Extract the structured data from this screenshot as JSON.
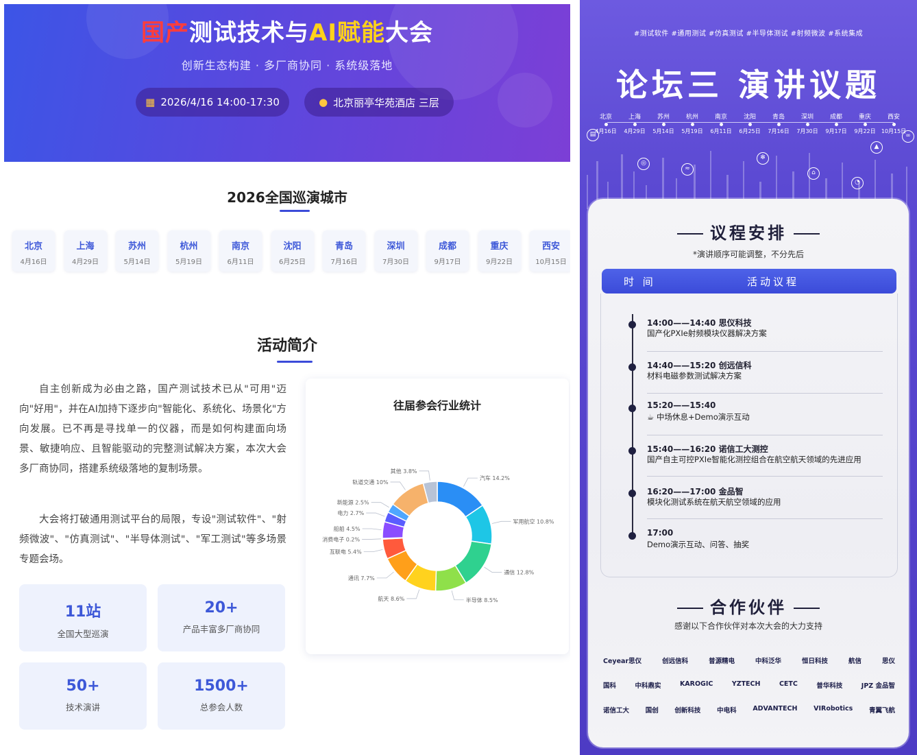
{
  "left": {
    "hero": {
      "title_red": "国产",
      "title_mid": "测试技术与",
      "title_ai": "AI",
      "title_gold": "赋能",
      "title_end": "大会",
      "subtitle": "创新生态构建 · 多厂商协同 · 系统级落地",
      "date": "2026/4/16 14:00-17:30",
      "venue": "北京丽亭华苑酒店 三层"
    },
    "tour": {
      "title": "2026全国巡演城市",
      "cities": [
        {
          "name": "北京",
          "date": "4月16日"
        },
        {
          "name": "上海",
          "date": "4月29日"
        },
        {
          "name": "苏州",
          "date": "5月14日"
        },
        {
          "name": "杭州",
          "date": "5月19日"
        },
        {
          "name": "南京",
          "date": "6月11日"
        },
        {
          "name": "沈阳",
          "date": "6月25日"
        },
        {
          "name": "青岛",
          "date": "7月16日"
        },
        {
          "name": "深圳",
          "date": "7月30日"
        },
        {
          "name": "成都",
          "date": "9月17日"
        },
        {
          "name": "重庆",
          "date": "9月22日"
        },
        {
          "name": "西安",
          "date": "10月15日"
        }
      ]
    },
    "intro": {
      "title": "活动简介",
      "p1": "自主创新成为必由之路，国产测试技术已从\"可用\"迈向\"好用\"，并在AI加持下逐步向\"智能化、系统化、场景化\"方向发展。已不再是寻找单一的仪器，而是如何构建面向场景、敏捷响应、且智能驱动的完整测试解决方案，本次大会多厂商协同，搭建系统级落地的复制场景。",
      "p2": "大会将打破通用测试平台的局限，专设\"测试软件\"、\"射频微波\"、\"仿真测试\"、\"半导体测试\"、\"军工测试\"等多场景专题会场。"
    },
    "stats": [
      {
        "num": "11站",
        "label": "全国大型巡演"
      },
      {
        "num": "20+",
        "label": "产品丰富多厂商协同"
      },
      {
        "num": "50+",
        "label": "技术演讲"
      },
      {
        "num": "1500+",
        "label": "总参会人数"
      }
    ]
  },
  "chart_data": {
    "type": "pie",
    "title": "往届参会行业统计",
    "categories": [
      "汽车",
      "军用航空",
      "通信",
      "半导体",
      "航天",
      "通讯",
      "互联电",
      "消费电子",
      "船舶",
      "电力",
      "新能源",
      "轨道交通",
      "其他"
    ],
    "values": [
      14.2,
      10.8,
      12.8,
      8.5,
      8.6,
      7.7,
      5.4,
      0.2,
      4.5,
      2.7,
      2.5,
      10.0,
      3.8
    ],
    "labels": [
      "汽车 14.2%",
      "军用航空 10.8%",
      "通信 12.8%",
      "半导体 8.5%",
      "航天 8.6%",
      "通讯 7.7%",
      "互联电 5.4%",
      "消费电子 0.2%",
      "船舶 4.5%",
      "电力 2.7%",
      "新能源 2.5%",
      "轨道交通 10%",
      "其他 3.8%"
    ],
    "colors": [
      "#2a8ef5",
      "#1ec6e6",
      "#2fd18f",
      "#8fe04a",
      "#ffd21e",
      "#ff9f1a",
      "#ff5a3c",
      "#ff4d8c",
      "#8a4dff",
      "#5a5dff",
      "#4fa7ff",
      "#f6b26b",
      "#b8c3d6"
    ],
    "legend": "labels"
  },
  "right": {
    "tags": "#测试软件 #通用测试 #仿真测试 #半导体测试 #射频微波 #系统集成",
    "title": "论坛三 演讲议题",
    "timeline": [
      {
        "city": "北京",
        "date": "4月16日"
      },
      {
        "city": "上海",
        "date": "4月29日"
      },
      {
        "city": "苏州",
        "date": "5月14日"
      },
      {
        "city": "杭州",
        "date": "5月19日"
      },
      {
        "city": "南京",
        "date": "6月11日"
      },
      {
        "city": "沈阳",
        "date": "6月25日"
      },
      {
        "city": "青岛",
        "date": "7月16日"
      },
      {
        "city": "深圳",
        "date": "7月30日"
      },
      {
        "city": "成都",
        "date": "9月17日"
      },
      {
        "city": "重庆",
        "date": "9月22日"
      },
      {
        "city": "西安",
        "date": "10月15日"
      }
    ],
    "agenda": {
      "title": "议程安排",
      "note": "*演讲顺序可能调整，不分先后",
      "col_time": "时 间",
      "col_topic": "活动议程",
      "items": [
        {
          "time": "14:00——14:40 思仪科技",
          "topic": "国产化PXIe射频模块仪器解决方案"
        },
        {
          "time": "14:40——15:20 创远信科",
          "topic": "材料电磁参数测试解决方案"
        },
        {
          "time": "15:20——15:40",
          "topic": "☕ 中场休息+Demo演示互动"
        },
        {
          "time": "15:40——16:20 诺信工大测控",
          "topic": "国产自主可控PXIe智能化测控组合在航空航天领域的先进应用"
        },
        {
          "time": "16:20——17:00 金品智",
          "topic": "模块化测试系统在航天航空领域的应用"
        },
        {
          "time": "17:00",
          "topic": "Demo演示互动、问答、抽奖"
        }
      ]
    },
    "partners": {
      "title": "合作伙伴",
      "note": "感谢以下合作伙伴对本次大会的大力支持",
      "rows": [
        [
          "Ceyear思仪",
          "创远信科",
          "普源精电",
          "中科泛华",
          "恒日科技",
          "航信",
          "思仪"
        ],
        [
          "国科",
          "中科鼎实",
          "KAROGIC",
          "YZTECH",
          "CETC",
          "普华科技",
          "JPZ 金品智"
        ],
        [
          "诺信工大",
          "国创",
          "创新科技",
          "中电科",
          "ADVANTECH",
          "VIRobotics",
          "青翼飞航"
        ]
      ]
    }
  }
}
